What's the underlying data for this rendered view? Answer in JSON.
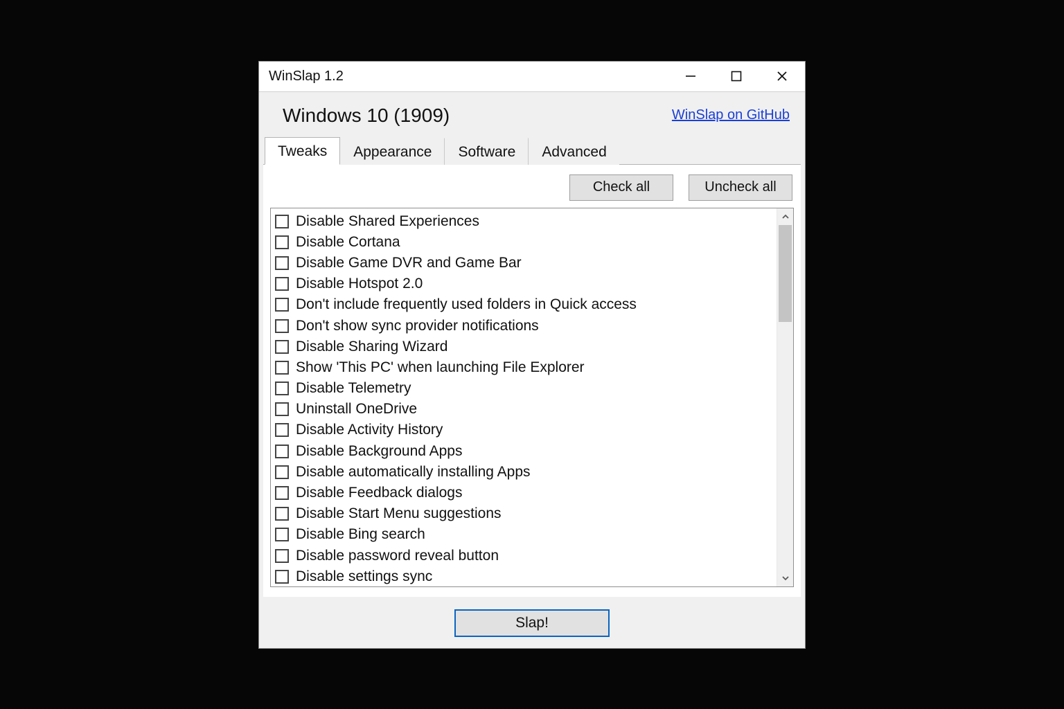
{
  "window": {
    "title": "WinSlap 1.2"
  },
  "header": {
    "subtitle": "Windows 10 (1909)",
    "github_link": "WinSlap on GitHub"
  },
  "tabs": [
    {
      "label": "Tweaks",
      "active": true
    },
    {
      "label": "Appearance",
      "active": false
    },
    {
      "label": "Software",
      "active": false
    },
    {
      "label": "Advanced",
      "active": false
    }
  ],
  "actions": {
    "check_all": "Check all",
    "uncheck_all": "Uncheck all"
  },
  "tweaks": [
    "Disable Shared Experiences",
    "Disable Cortana",
    "Disable Game DVR and Game Bar",
    "Disable Hotspot 2.0",
    "Don't include frequently used folders in Quick access",
    "Don't show sync provider notifications",
    "Disable Sharing Wizard",
    "Show 'This PC' when launching File Explorer",
    "Disable Telemetry",
    "Uninstall OneDrive",
    "Disable Activity History",
    "Disable Background Apps",
    "Disable automatically installing Apps",
    "Disable Feedback dialogs",
    "Disable Start Menu suggestions",
    "Disable Bing search",
    "Disable password reveal button",
    "Disable settings sync"
  ],
  "footer": {
    "slap": "Slap!"
  }
}
